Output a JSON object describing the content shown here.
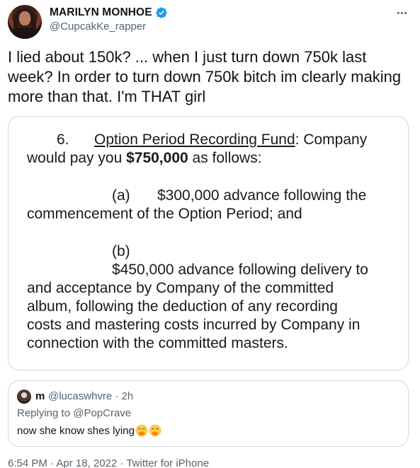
{
  "author": {
    "display_name": "MARILYN MONHOE",
    "handle": "@CupcakKe_rapper",
    "verified": true
  },
  "tweet_text": "I lied about 150k?  ... when I just turn down 750k last week? In order to turn down 750k bitch im clearly making more than that. I'm THAT girl",
  "document": {
    "number": "6.",
    "heading": "Option Period Recording Fund",
    "after_heading": ":  Company",
    "line2_pre": "would pay you ",
    "amount": "$750,000",
    "line2_post": " as follows:",
    "a_label": "(a)",
    "a_line1": "$300,000 advance following the",
    "a_line2": "commencement of the Option Period; and",
    "b_label": "(b)",
    "b_line1": "$450,000 advance following delivery to",
    "b_line2": "and acceptance by Company of the committed",
    "b_line3": "album, following the deduction of any recording",
    "b_line4": "costs and mastering costs incurred by Company in",
    "b_line5": "connection with the committed masters."
  },
  "quote": {
    "name": "m",
    "handle_time": "@lucaswhvre · 2h",
    "replying_to": "Replying to @PopCrave",
    "text": "now she know shes lying",
    "emojis": [
      "face-with-hand-over-mouth",
      "face-with-hand-over-mouth"
    ]
  },
  "timestamp": "6:54 PM · Apr 18, 2022 · Twitter for iPhone",
  "colors": {
    "verified_blue": "#1d9bf0",
    "secondary_text": "#536471",
    "border": "#cfd9de"
  }
}
